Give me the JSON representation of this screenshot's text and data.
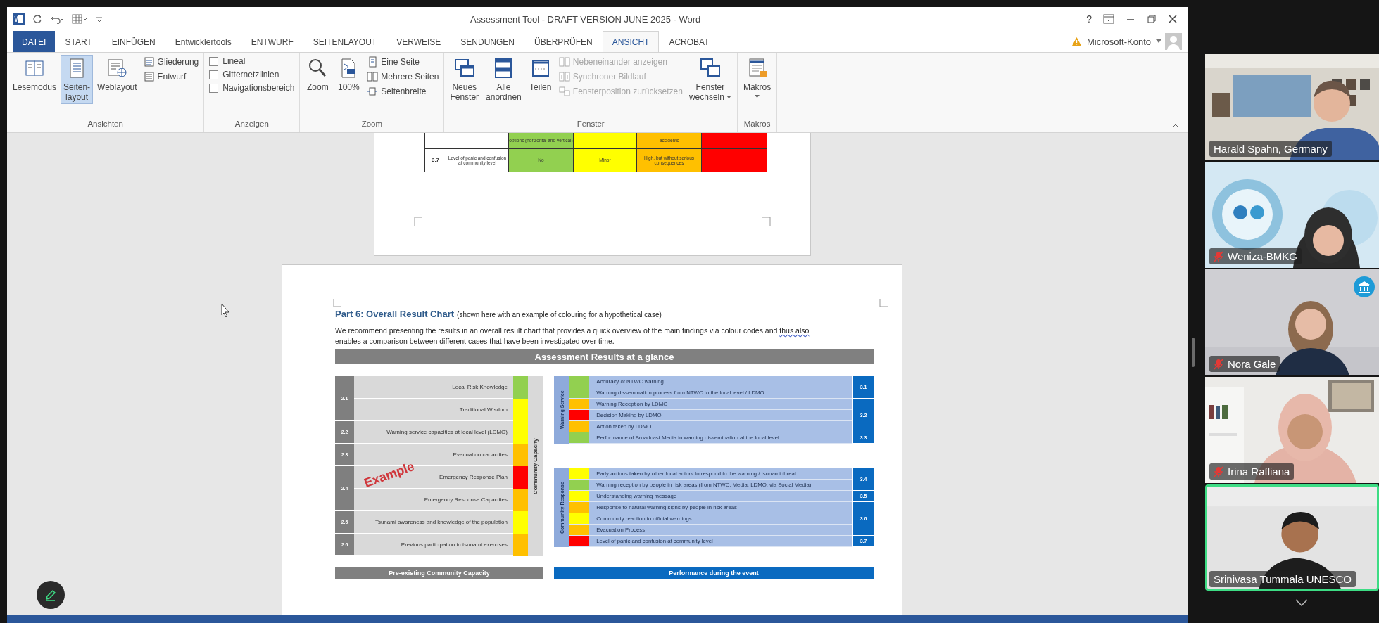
{
  "window": {
    "title": "Assessment Tool - DRAFT VERSION JUNE 2025 - Word",
    "help": "?"
  },
  "tabs": [
    {
      "label": "DATEI",
      "kind": "file",
      "selected": false
    },
    {
      "label": "START",
      "kind": "tab",
      "selected": false
    },
    {
      "label": "EINFÜGEN",
      "kind": "tab",
      "selected": false
    },
    {
      "label": "Entwicklertools",
      "kind": "tab",
      "selected": false
    },
    {
      "label": "ENTWURF",
      "kind": "tab",
      "selected": false
    },
    {
      "label": "SEITENLAYOUT",
      "kind": "tab",
      "selected": false
    },
    {
      "label": "VERWEISE",
      "kind": "tab",
      "selected": false
    },
    {
      "label": "SENDUNGEN",
      "kind": "tab",
      "selected": false
    },
    {
      "label": "ÜBERPRÜFEN",
      "kind": "tab",
      "selected": false
    },
    {
      "label": "ANSICHT",
      "kind": "tab",
      "selected": true
    },
    {
      "label": "ACROBAT",
      "kind": "tab",
      "selected": false
    }
  ],
  "account": "Microsoft-Konto",
  "ribbon": [
    {
      "label": "Ansichten",
      "items": [
        {
          "kind": "big",
          "lines": [
            "Lesemodus"
          ],
          "selected": false,
          "dropdown": false
        },
        {
          "kind": "big",
          "lines": [
            "Seiten-",
            "layout"
          ],
          "selected": true,
          "dropdown": false
        },
        {
          "kind": "big",
          "lines": [
            "Weblayout"
          ],
          "selected": false,
          "dropdown": false
        },
        {
          "kind": "stack",
          "items": [
            {
              "label": "Gliederung",
              "selected": false,
              "disabled": false
            },
            {
              "label": "Entwurf",
              "selected": false,
              "disabled": false
            }
          ]
        }
      ]
    },
    {
      "label": "Anzeigen",
      "items": [
        {
          "kind": "checks",
          "items": [
            {
              "label": "Lineal",
              "checked": false
            },
            {
              "label": "Gitternetzlinien",
              "checked": false
            },
            {
              "label": "Navigationsbereich",
              "checked": false
            }
          ]
        }
      ]
    },
    {
      "label": "Zoom",
      "items": [
        {
          "kind": "big",
          "lines": [
            "Zoom"
          ],
          "dropdown": false
        },
        {
          "kind": "big",
          "lines": [
            "100%"
          ],
          "dropdown": false
        },
        {
          "kind": "stack",
          "items": [
            {
              "label": "Eine Seite",
              "disabled": false
            },
            {
              "label": "Mehrere Seiten",
              "disabled": false
            },
            {
              "label": "Seitenbreite",
              "disabled": false
            }
          ]
        }
      ]
    },
    {
      "label": "Fenster",
      "items": [
        {
          "kind": "big",
          "lines": [
            "Neues",
            "Fenster"
          ],
          "dropdown": false
        },
        {
          "kind": "big",
          "lines": [
            "Alle",
            "anordnen"
          ],
          "dropdown": false
        },
        {
          "kind": "big",
          "lines": [
            "Teilen"
          ],
          "dropdown": false
        },
        {
          "kind": "stack",
          "items": [
            {
              "label": "Nebeneinander anzeigen",
              "disabled": true
            },
            {
              "label": "Synchroner Bildlauf",
              "disabled": true
            },
            {
              "label": "Fensterposition zurücksetzen",
              "disabled": true
            }
          ]
        },
        {
          "kind": "big",
          "lines": [
            "Fenster",
            "wechseln"
          ],
          "dropdown": true
        }
      ]
    },
    {
      "label": "Makros",
      "items": [
        {
          "kind": "big",
          "lines": [
            "Makros"
          ],
          "dropdown": true
        }
      ]
    }
  ],
  "previous_page": {
    "rows": [
      {
        "cells": [
          {
            "text": ""
          },
          {
            "text": ""
          },
          {
            "text": "options (horizontal and vertical)",
            "color": "#92d050"
          },
          {
            "color": "#ffff00"
          },
          {
            "text": "accidents",
            "color": "#ffc000"
          },
          {
            "color": "#ff0000"
          }
        ]
      },
      {
        "cells": [
          {
            "text": "3.7",
            "color": "#ffffff"
          },
          {
            "text": "Level of panic and confusion at community level",
            "color": "#ffffff"
          },
          {
            "text": "No",
            "color": "#92d050"
          },
          {
            "text": "Minor",
            "color": "#ffff00"
          },
          {
            "text": "High, but without serious consequences",
            "color": "#ffc000"
          },
          {
            "color": "#ff0000"
          }
        ]
      }
    ]
  },
  "page": {
    "heading": "Part 6: Overall Result Chart",
    "heading_note": "(shown here with an example of colouring for a hypothetical case)",
    "paragraph": {
      "line1": "We recommend presenting the results in an overall result chart that provides a quick overview of the main findings via colour codes and ",
      "flagged": "thus also",
      "line2": "enables a comparison between different cases that have been investigated over time."
    }
  },
  "results": {
    "title": "Assessment Results at a glance",
    "capacity": {
      "side_label": "Community Capacity",
      "stamp": "Example",
      "footer": "Pre-existing Community Capacity",
      "groups": [
        {
          "number": "2.1",
          "items": [
            {
              "label": "Local Risk Knowledge",
              "color": "#92d050"
            },
            {
              "label": "Traditional Wisdom",
              "color": "#ffff00"
            }
          ]
        },
        {
          "number": "2.2",
          "items": [
            {
              "label": "Warning service capacities at local level (LDMO)",
              "color": "#ffff00"
            }
          ]
        },
        {
          "number": "2.3",
          "items": [
            {
              "label": "Evacuation capacities",
              "color": "#ffc000"
            }
          ]
        },
        {
          "number": "2.4",
          "items": [
            {
              "label": "Emergency Response Plan",
              "color": "#ff0000"
            },
            {
              "label": "Emergency Response Capacities",
              "color": "#ffc000"
            }
          ]
        },
        {
          "number": "2.5",
          "items": [
            {
              "label": "Tsunami awareness and knowledge of the population",
              "color": "#ffff00"
            }
          ]
        },
        {
          "number": "2.6",
          "items": [
            {
              "label": "Previous participation in tsunami exercises",
              "color": "#ffc000"
            }
          ]
        }
      ]
    },
    "performance": {
      "footer": "Performance during the event",
      "sections": [
        {
          "side_label": "Warning Service",
          "groups": [
            {
              "number": "3.1",
              "items": [
                {
                  "label": "Accuracy of NTWC warning",
                  "color": "#92d050"
                },
                {
                  "label": "Warning dissemination process from NTWC to the local level / LDMO",
                  "color": "#92d050"
                }
              ]
            },
            {
              "number": "3.2",
              "items": [
                {
                  "label": "Warning Reception by LDMO",
                  "color": "#ffc000"
                },
                {
                  "label": "Decision Making by LDMO",
                  "color": "#ff0000"
                },
                {
                  "label": "Action taken by LDMO",
                  "color": "#ffc000"
                }
              ]
            },
            {
              "number": "3.3",
              "items": [
                {
                  "label": "Performance of Broadcast Media in warning dissemination at the local level",
                  "color": "#92d050"
                }
              ]
            }
          ]
        },
        {
          "side_label": "Community Response",
          "groups": [
            {
              "number": "3.4",
              "items": [
                {
                  "label": "Early actions taken by other local actors to respond to the warning / tsunami threat",
                  "color": "#ffff00"
                },
                {
                  "label": "Warning reception by people in risk areas (from NTWC, Media, LDMO, via Social Media)",
                  "color": "#92d050"
                }
              ]
            },
            {
              "number": "3.5",
              "items": [
                {
                  "label": "Understanding warning message",
                  "color": "#ffff00"
                }
              ]
            },
            {
              "number": "3.6",
              "items": [
                {
                  "label": "Response to natural warning signs by people in risk areas",
                  "color": "#ffc000"
                },
                {
                  "label": "Community reaction to official warnings",
                  "color": "#ffff00"
                },
                {
                  "label": "Evacuation Process",
                  "color": "#ffc000"
                }
              ]
            },
            {
              "number": "3.7",
              "items": [
                {
                  "label": "Level of panic and confusion at community level",
                  "color": "#ff0000"
                }
              ]
            }
          ]
        }
      ]
    }
  },
  "participants": [
    {
      "name": "Harald Spahn, Germany",
      "muted": false,
      "speaking": false,
      "org_badge": false
    },
    {
      "name": "Weniza-BMKG",
      "muted": true,
      "speaking": false,
      "org_badge": false
    },
    {
      "name": "Nora Gale",
      "muted": true,
      "speaking": false,
      "org_badge": true
    },
    {
      "name": "Irina Rafliana",
      "muted": true,
      "speaking": false,
      "org_badge": false
    },
    {
      "name": "Srinivasa Tummala UNESCO",
      "muted": false,
      "speaking": true,
      "org_badge": false
    }
  ]
}
